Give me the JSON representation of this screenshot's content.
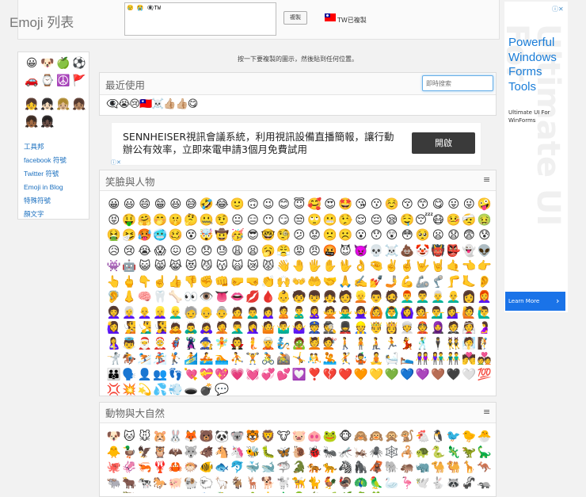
{
  "header": {
    "title": "Emoji 列表",
    "copy_box_value": "😢 😭 👁‍🗨TW",
    "copy_button": "複製",
    "status_text": "TW已複製"
  },
  "ad_right": {
    "close": "ⓘ✕",
    "headline": "Powerful Windows Forms Tools",
    "subtext": "Ultimate UI For WinForms",
    "cta": "Learn More",
    "cta_arrow": "›",
    "watermark": "Ultimate UI For"
  },
  "sidebar": {
    "category_icons": [
      "😀",
      "🐶",
      "🍏",
      "⚽",
      "🚗",
      "⌚",
      "☮️",
      "🚩"
    ],
    "skin_tones": [
      "👧",
      "👧🏻",
      "👧🏼",
      "👧🏽",
      "👧🏾",
      "👧🏿"
    ],
    "links": [
      "工具邦",
      "facebook 符號",
      "Twitter 符號",
      "Emoji in Blog",
      "特殊符號",
      "顏文字"
    ]
  },
  "instruction": "按一下要複製的圖示，然後貼到任何位置。",
  "recent": {
    "title": "最近使用",
    "search_placeholder": "即時搜索",
    "emojis": [
      "👁‍🗨",
      "😭",
      "😢",
      "🇹🇼",
      "☠️",
      "👍🏼",
      "👍🏼",
      "😋"
    ]
  },
  "banner": {
    "text": "SENNHEISER視訊會議系統，利用視訊設備直播簡報，讓行動辦公有效率，立即來電申請3個月免費試用",
    "button": "開啟",
    "ad_tag": "ⓘ✕"
  },
  "sections": [
    {
      "title": "笑臉與人物",
      "menu_icon": "≡",
      "emojis": [
        "😀",
        "😃",
        "😄",
        "😁",
        "😆",
        "😅",
        "🤣",
        "😂",
        "🙂",
        "🙃",
        "😉",
        "😊",
        "😇",
        "🥰",
        "😍",
        "🤩",
        "😘",
        "😗",
        "☺️",
        "😚",
        "😙",
        "😋",
        "😛",
        "😜",
        "🤪",
        "😝",
        "🤑",
        "🤗",
        "🤭",
        "🤫",
        "🤔",
        "🤐",
        "🤨",
        "😐",
        "😑",
        "😶",
        "😏",
        "😒",
        "🙄",
        "😬",
        "🤥",
        "😌",
        "😔",
        "😪",
        "🤤",
        "😴",
        "😷",
        "🤒",
        "🤕",
        "🤢",
        "🤮",
        "🤧",
        "🥵",
        "🥶",
        "🥴",
        "😵",
        "🤯",
        "🤠",
        "🥳",
        "😎",
        "🤓",
        "🧐",
        "😕",
        "😟",
        "🙁",
        "☹️",
        "😮",
        "😯",
        "😲",
        "😳",
        "🥺",
        "😦",
        "😧",
        "😨",
        "😰",
        "😥",
        "😢",
        "😭",
        "😱",
        "😖",
        "😣",
        "😞",
        "😓",
        "😩",
        "😫",
        "🥱",
        "😤",
        "😡",
        "😠",
        "🤬",
        "😈",
        "👿",
        "💀",
        "☠️",
        "💩",
        "🤡",
        "👹",
        "👺",
        "👻",
        "👽",
        "👾",
        "🤖",
        "😺",
        "😸",
        "😹",
        "😻",
        "😼",
        "😽",
        "🙀",
        "😿",
        "😾",
        "👋",
        "🤚",
        "🖐️",
        "✋",
        "🖖",
        "👌",
        "🤏",
        "✌️",
        "🤞",
        "🤟",
        "🤘",
        "🤙",
        "👈",
        "👉",
        "👆",
        "🖕",
        "👇",
        "☝️",
        "👍",
        "👎",
        "✊",
        "👊",
        "🤛",
        "🤜",
        "👏",
        "🙌",
        "👐",
        "🤲",
        "🤝",
        "🙏",
        "✍️",
        "💅",
        "🤳",
        "💪",
        "🦾",
        "🦿",
        "🦵",
        "🦶",
        "👂",
        "🦻",
        "👃",
        "🧠",
        "🦷",
        "🦴",
        "👀",
        "👁️",
        "👅",
        "👄",
        "💋",
        "🩸",
        "👶",
        "🧒",
        "👦",
        "👧",
        "🧑",
        "👱",
        "👨",
        "🧔",
        "👨‍🦰",
        "👨‍🦱",
        "👨‍🦳",
        "👨‍🦲",
        "👩",
        "👩‍🦰",
        "👩‍🦱",
        "👩‍🦳",
        "👩‍🦲",
        "👱‍♀️",
        "👱‍♂️",
        "🧓",
        "👴",
        "👵",
        "🙍",
        "🙍‍♂️",
        "🙍‍♀️",
        "🙎",
        "🙎‍♂️",
        "🙎‍♀️",
        "🙅",
        "🙅‍♂️",
        "🙅‍♀️",
        "🙆",
        "🙆‍♂️",
        "🙆‍♀️",
        "💁",
        "💁‍♂️",
        "💁‍♀️",
        "🙋",
        "🙋‍♂️",
        "🙋‍♀️",
        "🧏",
        "🧏‍♂️",
        "🧏‍♀️",
        "🙇",
        "🙇‍♂️",
        "🙇‍♀️",
        "🤦",
        "🤦‍♂️",
        "🤦‍♀️",
        "🤷",
        "🤷‍♂️",
        "🤷‍♀️",
        "👮",
        "🕵️",
        "💂",
        "👷",
        "🤴",
        "👸",
        "👳",
        "👲",
        "🧕",
        "🤵",
        "👰",
        "🤰",
        "🤱",
        "👼",
        "🎅",
        "🤶",
        "🦸",
        "🦹",
        "🧙",
        "🧚",
        "🧛",
        "🧜",
        "🧝",
        "🧞",
        "🧟",
        "💆",
        "💇",
        "🚶",
        "🧍",
        "🧎",
        "🏃",
        "💃",
        "🕺",
        "🕴️",
        "👯",
        "🧖",
        "🧗",
        "🤺",
        "🏇",
        "⛷️",
        "🏂",
        "🏌️",
        "🏄",
        "🚣",
        "🏊",
        "⛹️",
        "🏋️",
        "🚴",
        "🚵",
        "🤸",
        "🤼",
        "🤽",
        "🤾",
        "🤹",
        "🧘",
        "🛀",
        "🛌",
        "👭",
        "👫",
        "👬",
        "💏",
        "💑",
        "👪",
        "🗣️",
        "👤",
        "👥",
        "👣",
        "💘",
        "💝",
        "💖",
        "💗",
        "💓",
        "💞",
        "💕",
        "💟",
        "❣️",
        "💔",
        "❤️",
        "🧡",
        "💛",
        "💚",
        "💙",
        "💜",
        "🤎",
        "🖤",
        "🤍",
        "💯",
        "💢",
        "💥",
        "💫",
        "💦",
        "💨",
        "🕳️",
        "💣",
        "💬"
      ]
    },
    {
      "title": "動物與大自然",
      "menu_icon": "≡",
      "emojis": [
        "🐶",
        "🐱",
        "🐭",
        "🐹",
        "🐰",
        "🦊",
        "🐻",
        "🐼",
        "🐨",
        "🐯",
        "🦁",
        "🐮",
        "🐷",
        "🐽",
        "🐸",
        "🐵",
        "🙈",
        "🙉",
        "🙊",
        "🐒",
        "🐔",
        "🐧",
        "🐦",
        "🐤",
        "🐣",
        "🐥",
        "🦆",
        "🦅",
        "🦉",
        "🦇",
        "🐺",
        "🐗",
        "🐴",
        "🦄",
        "🐝",
        "🐛",
        "🦋",
        "🐌",
        "🐞",
        "🐜",
        "🦟",
        "🦗",
        "🕷️",
        "🕸️",
        "🦂",
        "🐢",
        "🐍",
        "🦎",
        "🦖",
        "🦕",
        "🐙",
        "🦑",
        "🦐",
        "🦞",
        "🦀",
        "🐡",
        "🐠",
        "🐟",
        "🐬",
        "🐳",
        "🐋",
        "🦈",
        "🐊",
        "🐅",
        "🐆",
        "🦓",
        "🦍",
        "🦧",
        "🐘",
        "🦛",
        "🦏",
        "🐪",
        "🐫",
        "🦒",
        "🦘",
        "🐃",
        "🐂",
        "🐄",
        "🐎",
        "🐖",
        "🐏",
        "🐑",
        "🦙",
        "🐐",
        "🦌",
        "🐕",
        "🐩",
        "🦮",
        "🐈",
        "🐓",
        "🦃",
        "🦚",
        "🦜",
        "🦢",
        "🦩",
        "🕊️",
        "🐇",
        "🦝",
        "🦨",
        "🦡",
        "🦦",
        "🦥",
        "🐁",
        "🐀",
        "🐿️",
        "🦔",
        "🐾",
        "🐉",
        "🐲",
        "🌵",
        "🎄",
        "🌲",
        "🌳",
        "🌴",
        "🌱",
        "🌿",
        "☘️",
        "🍀"
      ]
    }
  ]
}
